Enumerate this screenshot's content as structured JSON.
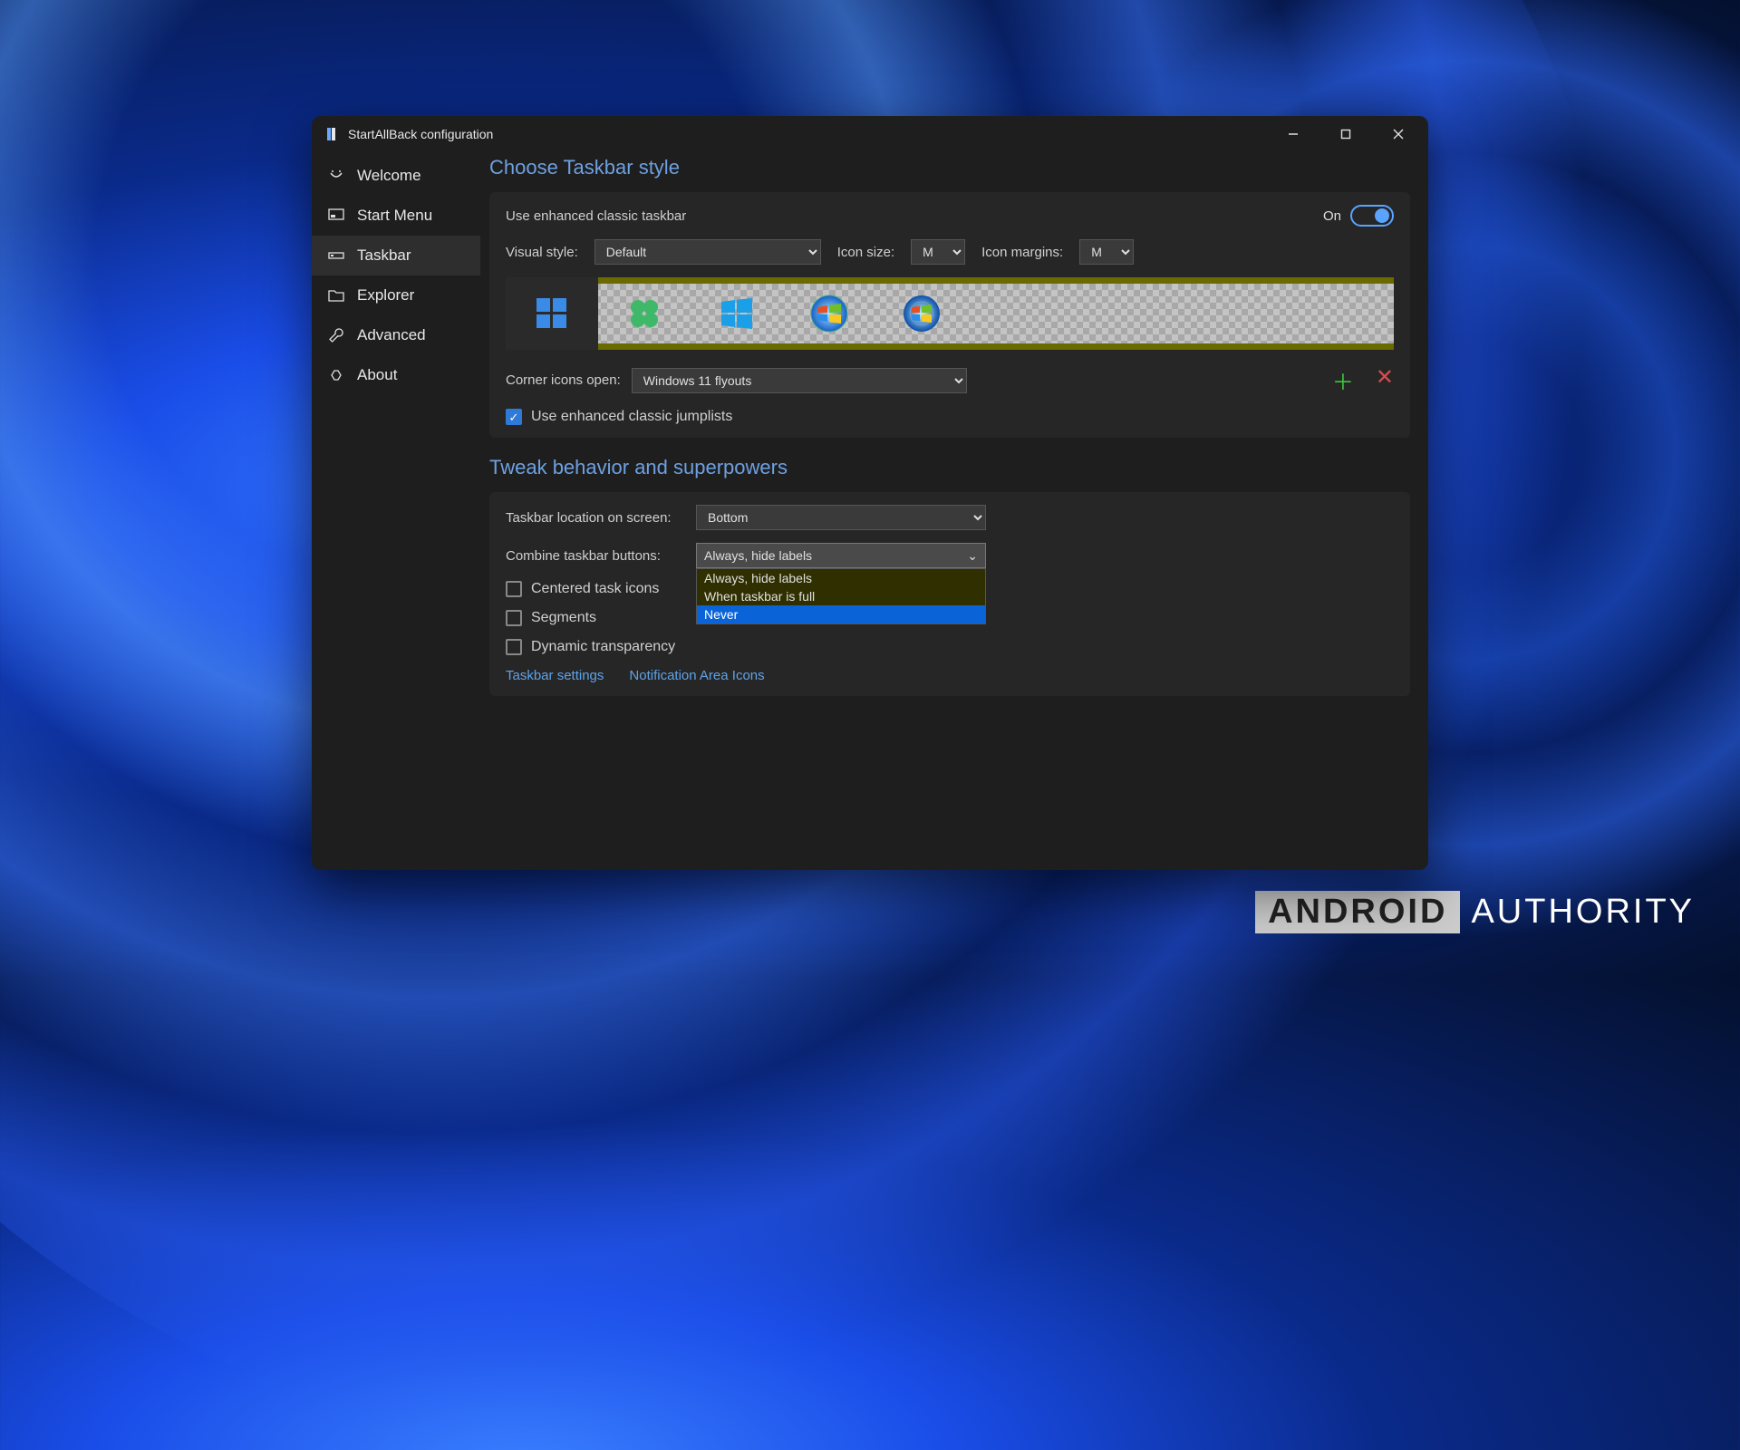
{
  "window": {
    "title": "StartAllBack configuration"
  },
  "sidebar": {
    "items": [
      {
        "label": "Welcome",
        "icon": "smile-icon"
      },
      {
        "label": "Start Menu",
        "icon": "monitor-icon"
      },
      {
        "label": "Taskbar",
        "icon": "taskbar-icon",
        "selected": true
      },
      {
        "label": "Explorer",
        "icon": "folder-icon"
      },
      {
        "label": "Advanced",
        "icon": "wrench-icon"
      },
      {
        "label": "About",
        "icon": "info-icon"
      }
    ]
  },
  "section1": {
    "title": "Choose Taskbar style",
    "enhancedTaskbar": {
      "label": "Use enhanced classic taskbar",
      "state": "On",
      "on": true
    },
    "visualStyle": {
      "label": "Visual style:",
      "value": "Default"
    },
    "iconSize": {
      "label": "Icon size:",
      "value": "M"
    },
    "iconMargins": {
      "label": "Icon margins:",
      "value": "M"
    },
    "startIcons": [
      "win11-blue",
      "clover-green",
      "win10-tile",
      "win7-orb",
      "vista-orb"
    ],
    "cornerIcons": {
      "label": "Corner icons open:",
      "value": "Windows 11 flyouts"
    },
    "jumplists": {
      "label": "Use enhanced classic jumplists",
      "checked": true
    }
  },
  "section2": {
    "title": "Tweak behavior and superpowers",
    "location": {
      "label": "Taskbar location on screen:",
      "value": "Bottom"
    },
    "combine": {
      "label": "Combine taskbar buttons:",
      "value": "Always, hide labels",
      "options": [
        "Always, hide labels",
        "When taskbar is full",
        "Never"
      ],
      "highlighted": "Never"
    },
    "centered": {
      "label": "Centered task icons",
      "checked": false
    },
    "segments": {
      "label": "Segments",
      "checked": false
    },
    "dynamicTransparency": {
      "label": "Dynamic transparency",
      "checked": false
    },
    "links": {
      "taskbarSettings": "Taskbar settings",
      "notificationIcons": "Notification Area Icons"
    }
  },
  "watermark": {
    "brand": "ANDROID",
    "suffix": "AUTHORITY"
  }
}
